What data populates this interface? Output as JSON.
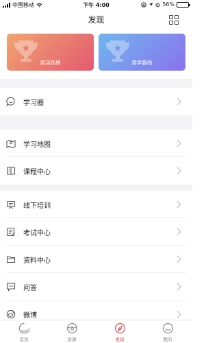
{
  "status_bar": {
    "carrier": "中国移动",
    "time": "下午 4:00",
    "battery": "56%",
    "battery_level": 0.56
  },
  "header": {
    "title": "发现",
    "action_icon": "grid-icon"
  },
  "rank_cards": [
    {
      "label": "周活跃榜",
      "icon": "trophy-icon",
      "gradient": [
        "#f1a46f",
        "#e35a70"
      ]
    },
    {
      "label": "周学霸榜",
      "icon": "trophy-icon",
      "gradient": [
        "#6fb6ef",
        "#8a72ec"
      ]
    }
  ],
  "menu": [
    {
      "label": "学习圈",
      "icon": "smiley-chat-icon"
    },
    {
      "label": "学习地图",
      "icon": "map-icon"
    },
    {
      "label": "课程中心",
      "icon": "book-icon"
    },
    {
      "label": "线下培训",
      "icon": "presentation-icon"
    },
    {
      "label": "考试中心",
      "icon": "exam-icon"
    },
    {
      "label": "资料中心",
      "icon": "folder-icon"
    },
    {
      "label": "问答",
      "icon": "chat-icon"
    },
    {
      "label": "微博",
      "icon": "weibo-icon"
    }
  ],
  "tab_bar": {
    "items": [
      {
        "label": "首页",
        "icon": "home-icon"
      },
      {
        "label": "资源",
        "icon": "resource-icon"
      },
      {
        "label": "发现",
        "icon": "discover-icon"
      },
      {
        "label": "我的",
        "icon": "profile-icon"
      }
    ],
    "active_index": 2,
    "active_color": "#e0484a",
    "inactive_color": "#888888"
  }
}
